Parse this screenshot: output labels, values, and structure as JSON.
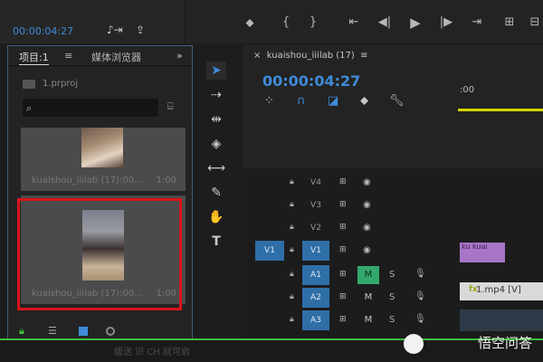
{
  "top": {
    "timecode": "00:00:04:27",
    "transport_icons": [
      "marker-icon",
      "in-point-icon",
      "out-point-icon",
      "go-to-in-icon",
      "step-back-icon",
      "play-icon",
      "step-forward-icon",
      "go-to-out-icon"
    ]
  },
  "project": {
    "tabs": [
      "项目:1",
      "媒体浏览器"
    ],
    "file_name": "1.prproj",
    "clips": [
      {
        "name": "kuaishou_iiilab (17):00...",
        "duration": "1:00"
      },
      {
        "name": "kuaishou_iiilab (17):00...",
        "duration": "1:00"
      }
    ]
  },
  "timeline": {
    "sequence_name": "kuaishou_iiilab (17)",
    "timecode": "00:00:04:27",
    "ruler_label": ":00",
    "tracks": [
      {
        "name": "V4",
        "target": ""
      },
      {
        "name": "V3",
        "target": ""
      },
      {
        "name": "V2",
        "target": ""
      },
      {
        "name": "V1",
        "target": "V1"
      },
      {
        "name": "A1",
        "target": "",
        "mute": "M",
        "solo": "S"
      },
      {
        "name": "A2",
        "target": "",
        "mute": "M",
        "solo": "S"
      },
      {
        "name": "A3",
        "target": "",
        "mute": "M",
        "solo": "S"
      }
    ],
    "v2_clip_label": "ku kuai",
    "v1_clip_label": "1.mp4 [V]",
    "fx_label": "fx"
  },
  "watermark": "悟空问答",
  "footer_fragment": "缓送 识 CH 就可启"
}
